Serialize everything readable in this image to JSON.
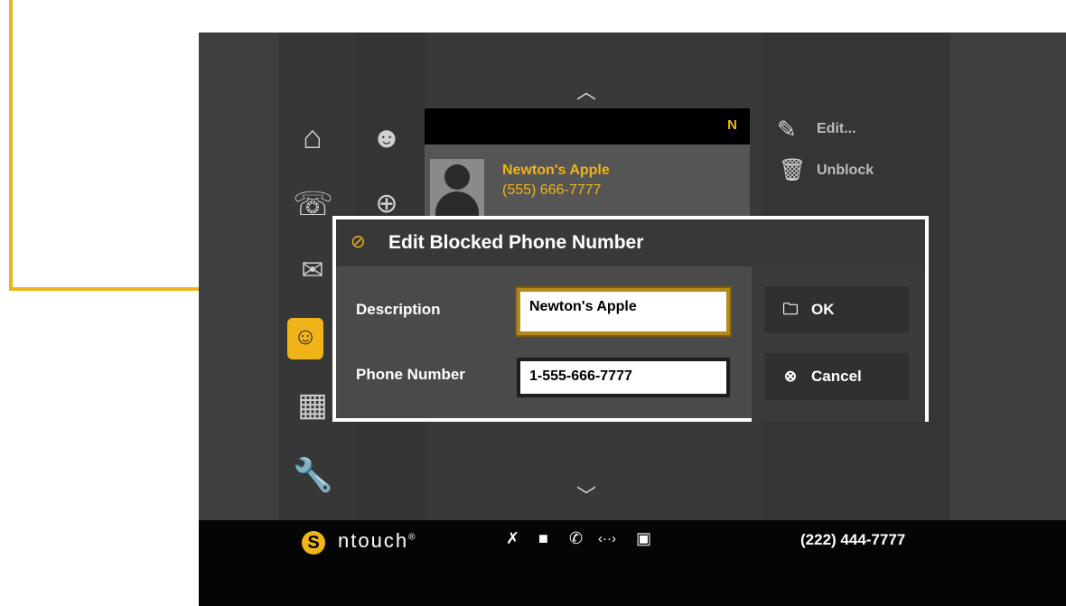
{
  "contacts_list": {
    "header_letter": "N",
    "contact_name": "Newton's Apple",
    "contact_number": "(555) 666-7777"
  },
  "actions": [
    {
      "label": "Edit...",
      "icon": "pencil-icon"
    },
    {
      "label": "Unblock",
      "icon": "trash-icon"
    }
  ],
  "dialog": {
    "title": "Edit Blocked Phone Number",
    "description_label": "Description",
    "description_value": "Newton's Apple",
    "phone_label": "Phone Number",
    "phone_value": "1-555-666-7777",
    "ok_label": "OK",
    "cancel_label": "Cancel"
  },
  "taskbar": {
    "brand": "ntouch",
    "brand_mark": "®",
    "phone_number": "(222) 444-7777"
  },
  "colors": {
    "accent": "#f0b418",
    "background": "#3f3f3f"
  }
}
